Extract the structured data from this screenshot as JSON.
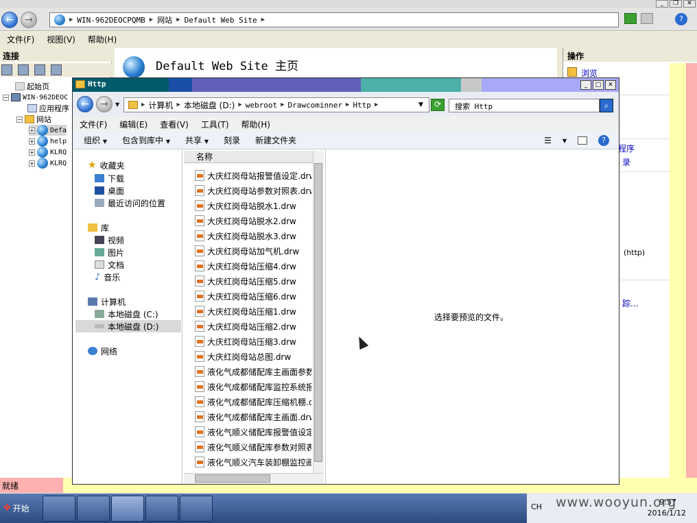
{
  "iis": {
    "address_parts": [
      "WIN-962DEOCPQMB",
      "网站",
      "Default Web Site"
    ],
    "menu": [
      "文件(F)",
      "视图(V)",
      "帮助(H)"
    ],
    "connections_title": "连接",
    "tree": [
      {
        "label": "起始页"
      },
      {
        "label": "WIN-962DEOC"
      },
      {
        "label": "应用程序"
      },
      {
        "label": "网站"
      },
      {
        "label": "Defa"
      },
      {
        "label": "help"
      },
      {
        "label": "KLRQ"
      },
      {
        "label": "KLRQ"
      }
    ],
    "home_title": "Default Web Site 主页",
    "actions_title": "操作",
    "actions": [
      "浏览",
      "程序",
      "录",
      "(http)",
      "踪..."
    ],
    "status": "就绪"
  },
  "explorer": {
    "title": "Http",
    "address_parts": [
      "计算机",
      "本地磁盘 (D:)",
      "webroot",
      "Drawcominner",
      "Http"
    ],
    "search_placeholder": "搜索 Http",
    "menu": [
      "文件(F)",
      "编辑(E)",
      "查看(V)",
      "工具(T)",
      "帮助(H)"
    ],
    "commands": [
      "组织",
      "包含到库中",
      "共享",
      "刻录",
      "新建文件夹"
    ],
    "nav": {
      "favorites": "收藏夹",
      "favorites_items": [
        "下载",
        "桌面",
        "最近访问的位置"
      ],
      "libraries": "库",
      "libraries_items": [
        "视频",
        "图片",
        "文档",
        "音乐"
      ],
      "computer": "计算机",
      "computer_items": [
        "本地磁盘 (C:)",
        "本地磁盘 (D:)"
      ],
      "network": "网络"
    },
    "column_name": "名称",
    "files": [
      "大庆红岗母站报警值设定.drw",
      "大庆红岗母站参数对照表.drw",
      "大庆红岗母站脱水1.drw",
      "大庆红岗母站脱水2.drw",
      "大庆红岗母站脱水3.drw",
      "大庆红岗母站加气机.drw",
      "大庆红岗母站压缩4.drw",
      "大庆红岗母站压缩5.drw",
      "大庆红岗母站压缩6.drw",
      "大庆红岗母站压缩1.drw",
      "大庆红岗母站压缩2.drw",
      "大庆红岗母站压缩3.drw",
      "大庆红岗母站总图.drw",
      "液化气成都储配库主画面参数",
      "液化气成都储配库监控系统报",
      "液化气成都储配库压缩机棚.d",
      "液化气成都储配库主画面.drw",
      "液化气顺义储配库报警值设定",
      "液化气顺义储配库参数对照表",
      "液化气顺义汽车装卸棚监控画"
    ],
    "preview_message": "选择要预览的文件。"
  },
  "taskbar": {
    "start": "开始",
    "lang": "CH",
    "time": "9:57",
    "date": "2016/1/12"
  },
  "watermark": "www.wooyun.org",
  "colors": {
    "title_segments": [
      "#005a6a",
      "#1a4fa8",
      "#6060b8",
      "#4cb0a8",
      "#a8a8f8"
    ]
  }
}
